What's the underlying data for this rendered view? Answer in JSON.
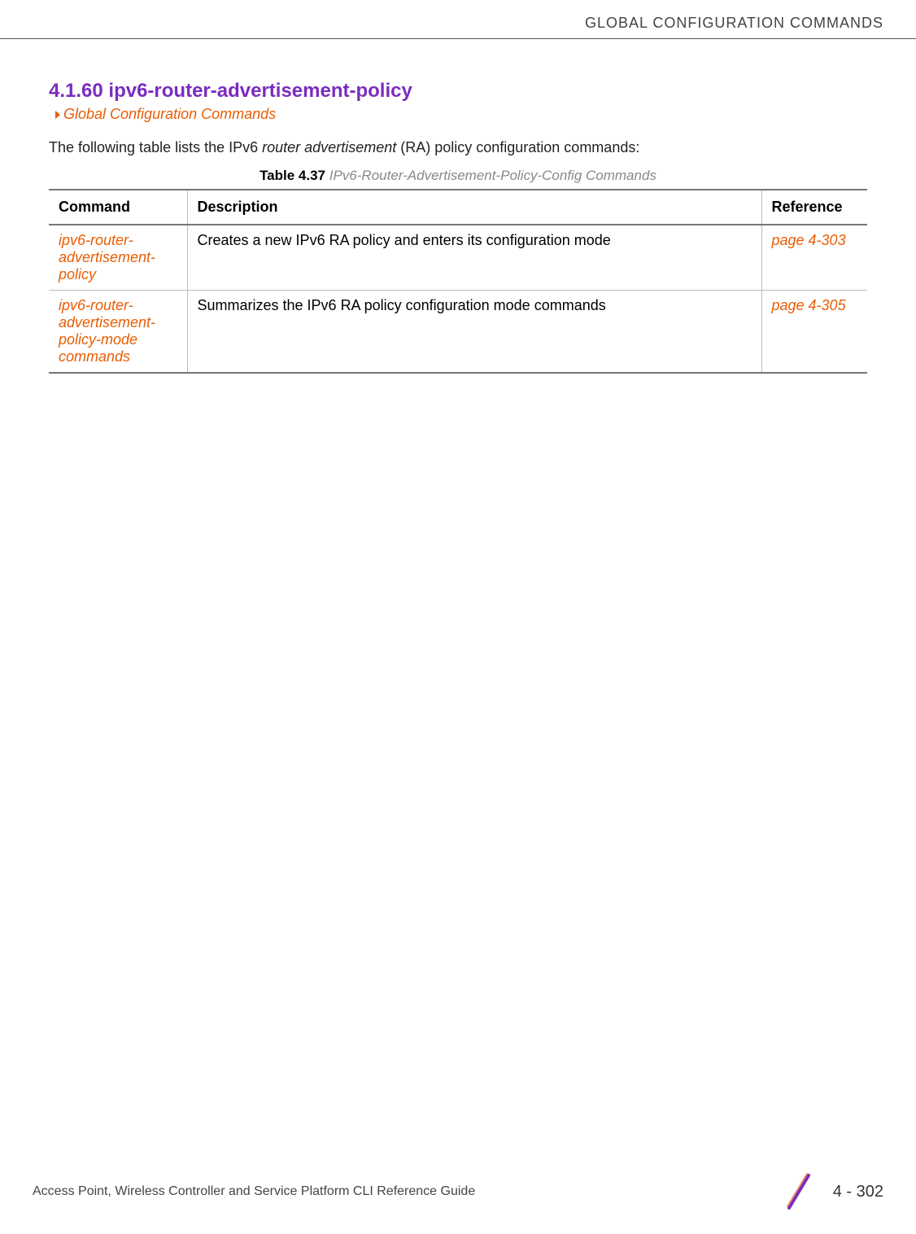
{
  "header": {
    "title": "GLOBAL CONFIGURATION COMMANDS"
  },
  "section": {
    "number": "4.1.60",
    "title": "ipv6-router-advertisement-policy",
    "breadcrumb": "Global Configuration Commands"
  },
  "intro": {
    "prefix": "The following table lists the IPv6 ",
    "italic": "router advertisement",
    "suffix": " (RA) policy configuration commands:"
  },
  "table": {
    "caption_label": "Table 4.37",
    "caption_title": "IPv6-Router-Advertisement-Policy-Config Commands",
    "headers": {
      "command": "Command",
      "description": "Description",
      "reference": "Reference"
    },
    "rows": [
      {
        "command": "ipv6-router-advertisement-policy",
        "description": "Creates a new IPv6 RA policy and enters its configuration mode",
        "reference": "page 4-303"
      },
      {
        "command": "ipv6-router-advertisement-policy-mode commands",
        "description": "Summarizes the IPv6 RA policy configuration mode commands",
        "reference": "page 4-305"
      }
    ]
  },
  "footer": {
    "text": "Access Point, Wireless Controller and Service Platform CLI Reference Guide",
    "page": "4 - 302"
  }
}
